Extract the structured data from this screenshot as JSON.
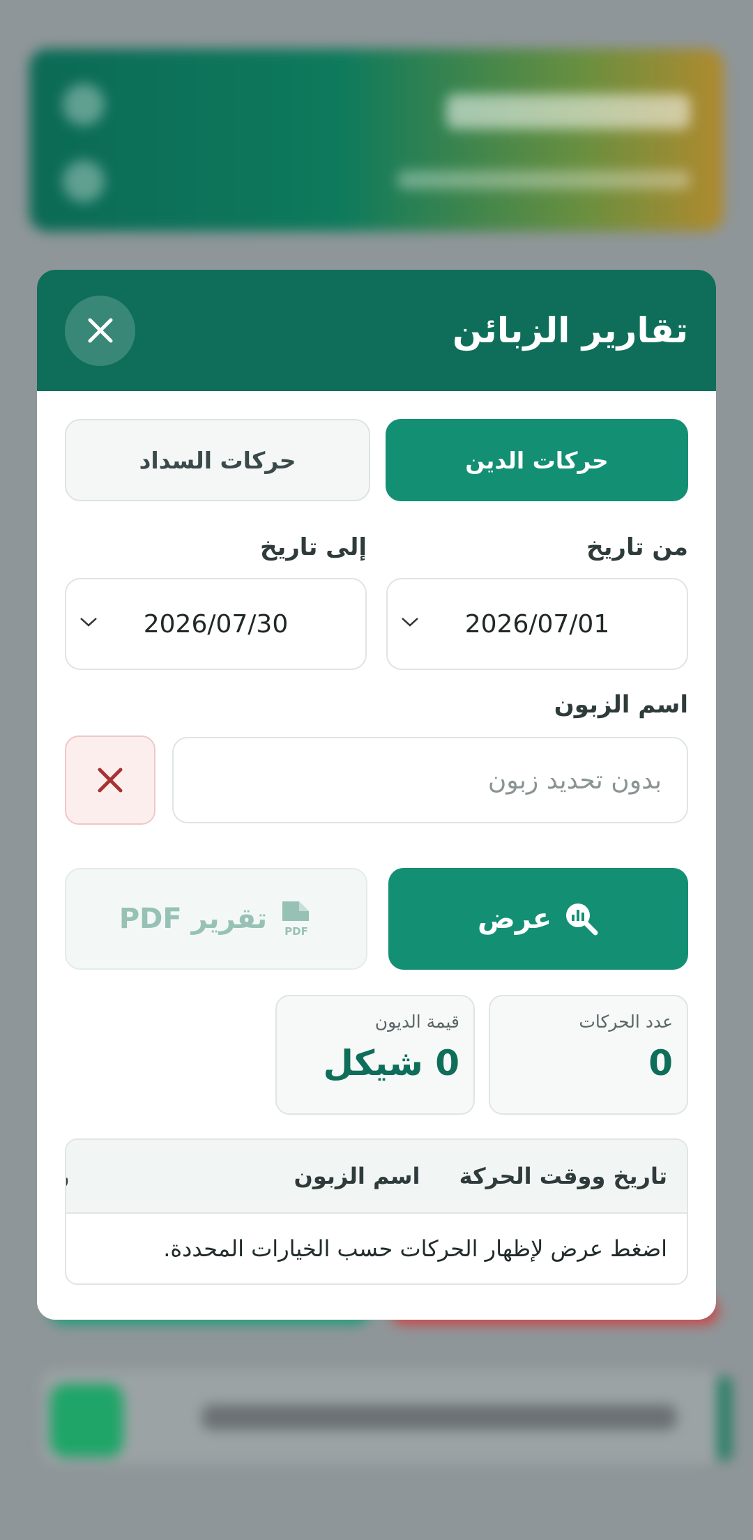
{
  "modal": {
    "title": "تقارير الزبائن",
    "tabs": [
      {
        "label": "حركات الدين",
        "active": true
      },
      {
        "label": "حركات السداد",
        "active": false
      }
    ],
    "from_date": {
      "label": "من تاريخ",
      "value": "2026/07/01"
    },
    "to_date": {
      "label": "إلى تاريخ",
      "value": "2026/07/30"
    },
    "customer": {
      "label": "اسم الزبون",
      "placeholder": "بدون تحديد زبون"
    },
    "buttons": {
      "show": "عرض",
      "pdf": "تقرير PDF"
    },
    "stats": [
      {
        "label": "عدد الحركات",
        "value": "0"
      },
      {
        "label": "قيمة الديون",
        "value": "0 شيكل"
      }
    ],
    "table": {
      "columns": [
        "تاريخ ووقت الحركة",
        "اسم الزبون",
        "ر"
      ],
      "empty_message": "اضغط عرض لإظهار الحركات حسب الخيارات المحددة."
    }
  },
  "colors": {
    "primary": "#138f74",
    "header": "#0e6e5a",
    "danger": "#a83232"
  }
}
